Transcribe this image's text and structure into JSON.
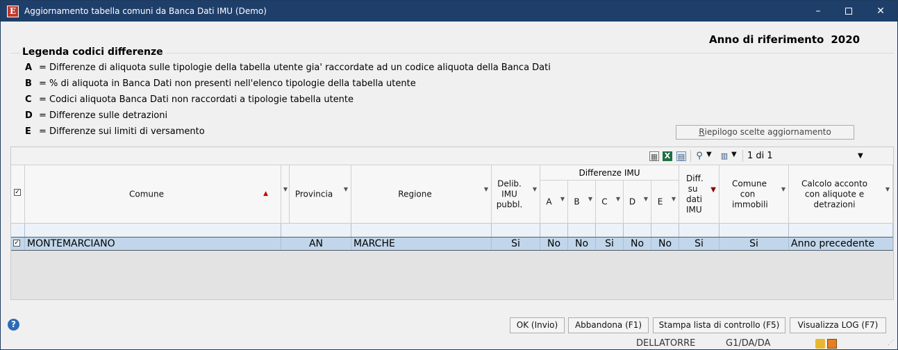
{
  "window": {
    "title": "Aggiornamento tabella comuni da Banca Dati IMU  (Demo)",
    "app_icon": "E",
    "min_glyph": "–",
    "close_glyph": "✕"
  },
  "anno": {
    "label": "Anno di riferimento",
    "value": "2020"
  },
  "legend": {
    "title": "Legenda codici differenze",
    "items": [
      {
        "code": "A",
        "text": "= Differenze di aliquota sulle tipologie della tabella utente gia' raccordate ad un codice aliquota della Banca Dati"
      },
      {
        "code": "B",
        "text": "= % di aliquota in Banca Dati non presenti nell'elenco tipologie della tabella utente"
      },
      {
        "code": "C",
        "text": "= Codici aliquota Banca Dati non raccordati a tipologie tabella utente"
      },
      {
        "code": "D",
        "text": "= Differenze sulle detrazioni"
      },
      {
        "code": "E",
        "text": "= Differenze sui limiti di versamento"
      }
    ],
    "riepilogo_button": {
      "mnemonic": "R",
      "rest": "iepilogo scelte aggiornamento"
    }
  },
  "toolbar": {
    "page_label": "1 di 1",
    "icons": [
      "grid-layout-icon",
      "excel-export-icon",
      "grid-view-icon",
      "zoom-search-icon",
      "columns-icon"
    ]
  },
  "columns": {
    "comune": "Comune",
    "provincia": "Provincia",
    "regione": "Regione",
    "delib": "Delib. IMU pubbl.",
    "differenze_group": "Differenze IMU",
    "diff_a": "A",
    "diff_b": "B",
    "diff_c": "C",
    "diff_d": "D",
    "diff_e": "E",
    "diff_su_dati": "Diff. su dati IMU",
    "comune_immobili": "Comune con immobili",
    "calcolo_acconto": "Calcolo acconto con aliquote e detrazioni"
  },
  "rows": [
    {
      "checked": true,
      "comune": "MONTEMARCIANO",
      "provincia": "AN",
      "regione": "MARCHE",
      "delib": "Si",
      "a": "No",
      "b": "No",
      "c": "Si",
      "d": "No",
      "e": "No",
      "diff_su_dati": "Si",
      "comune_immobili": "Si",
      "calcolo_acconto": "Anno precedente"
    }
  ],
  "buttons": {
    "ok": "OK (Invio)",
    "abbandona": "Abbandona (F1)",
    "stampa": "Stampa lista di controllo (F5)",
    "visualizza": "Visualizza LOG (F7)"
  },
  "status": {
    "user": "DELLATORRE",
    "code": "G1/DA/DA"
  },
  "colors": {
    "titlebar": "#1f3f6b",
    "selected_row": "#c1d6ea",
    "help": "#2c6bb5"
  }
}
